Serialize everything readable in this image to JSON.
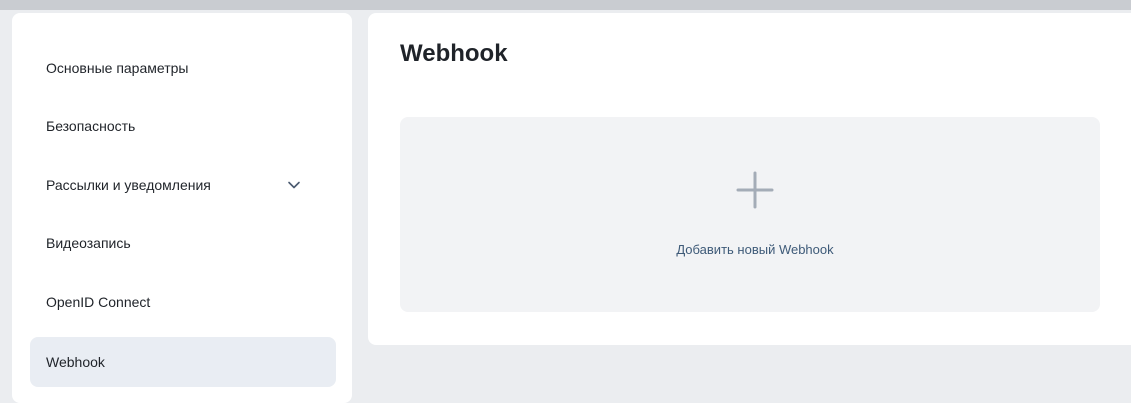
{
  "sidebar": {
    "items": [
      {
        "label": "Основные параметры",
        "active": false
      },
      {
        "label": "Безопасность",
        "active": false
      },
      {
        "label": "Рассылки и уведомления",
        "active": false,
        "expandable": true,
        "icon": "chevron-down-icon"
      },
      {
        "label": "Видеозапись",
        "active": false
      },
      {
        "label": "OpenID Connect",
        "active": false
      },
      {
        "label": "Webhook",
        "active": true
      }
    ]
  },
  "main": {
    "title": "Webhook",
    "add_card": {
      "icon": "plus-icon",
      "label": "Добавить новый Webhook"
    }
  },
  "colors": {
    "background": "#ebedf0",
    "active_item": "#e9edf3",
    "card": "#f2f3f5",
    "link_text": "#3e5a78",
    "plus_icon": "#a4acb7"
  }
}
